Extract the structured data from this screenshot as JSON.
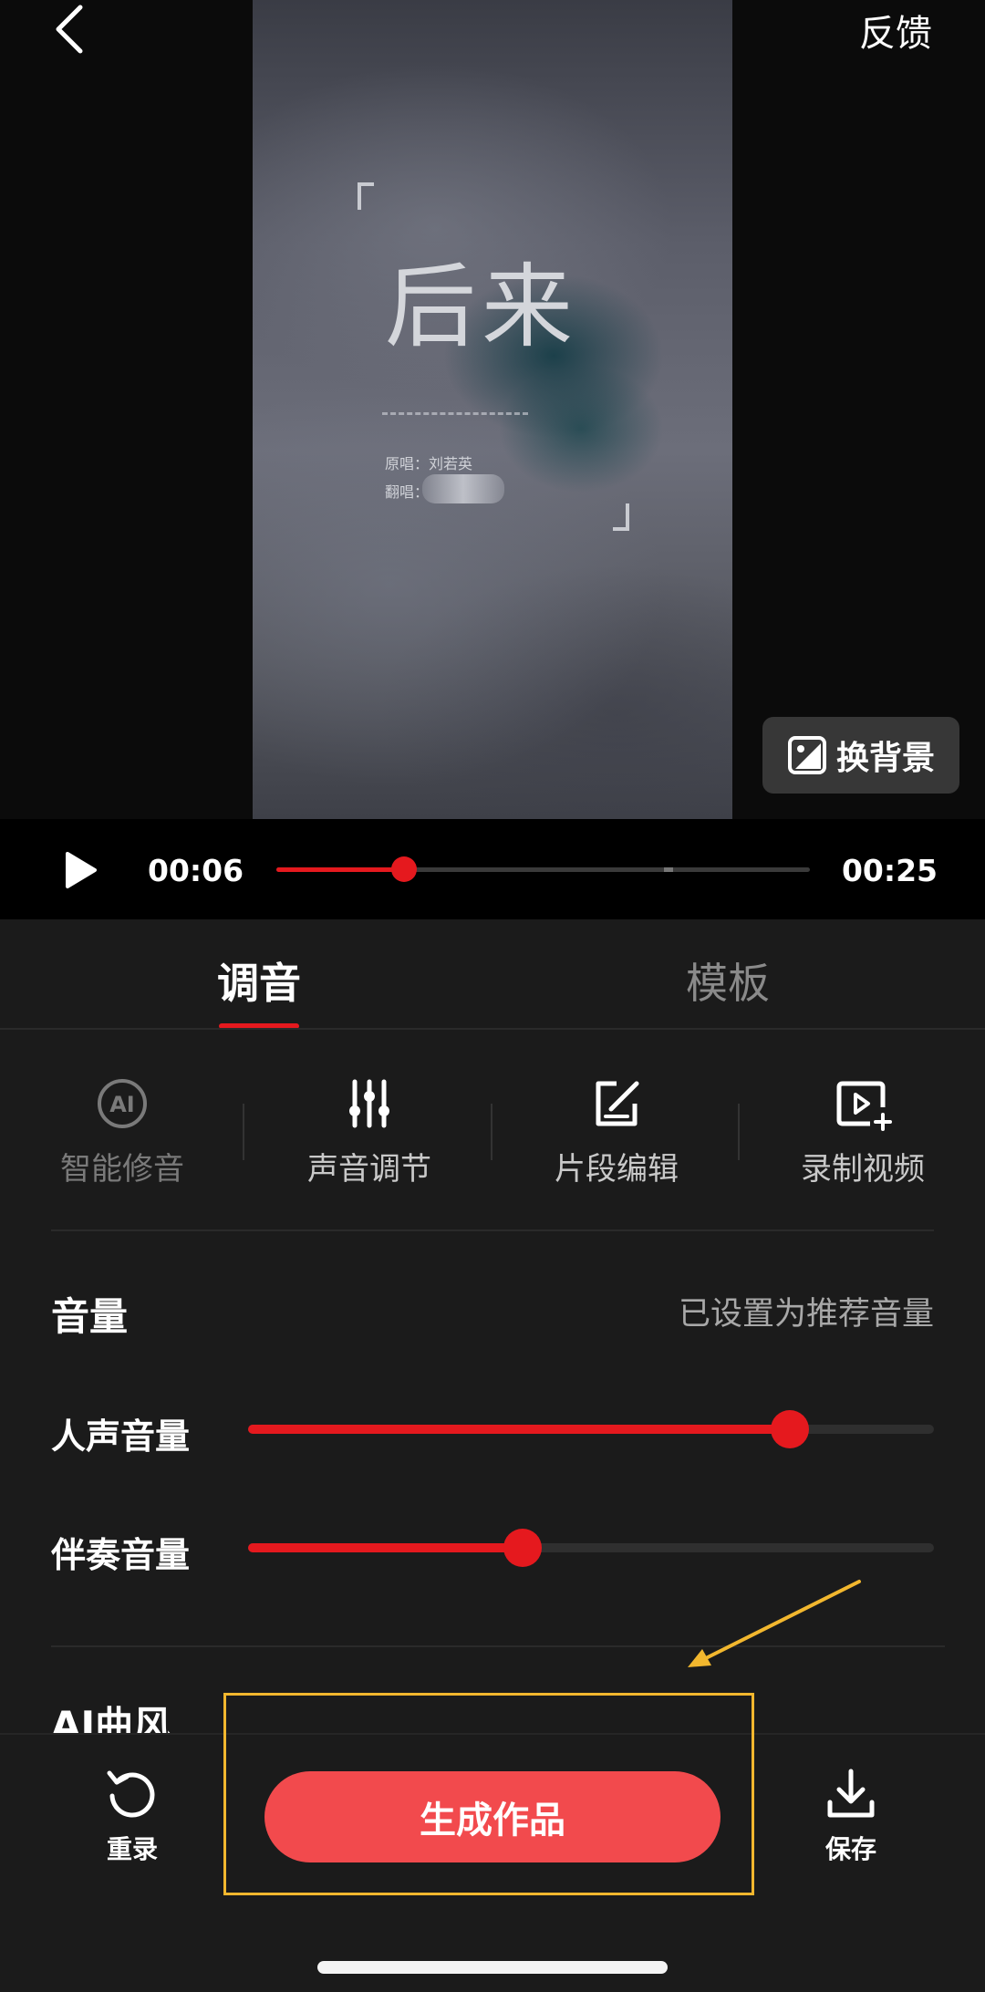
{
  "header": {
    "back_icon": "chevron-left-icon",
    "feedback_label": "反馈"
  },
  "video": {
    "title": "后来",
    "credit_original": "原唱：刘若英",
    "credit_cover": "翻唱："
  },
  "change_background": {
    "icon": "image-background-icon",
    "label": "换背景"
  },
  "player": {
    "play_icon": "play-icon",
    "current_time": "00:06",
    "total_time": "00:25",
    "progress_fraction": 0.24
  },
  "tabs": [
    {
      "label": "调音",
      "active": true
    },
    {
      "label": "模板",
      "active": false
    }
  ],
  "tools": [
    {
      "icon": "ai-badge-icon",
      "label": "智能修音",
      "enabled": false
    },
    {
      "icon": "equalizer-sliders-icon",
      "label": "声音调节",
      "enabled": true
    },
    {
      "icon": "edit-square-icon",
      "label": "片段编辑",
      "enabled": true
    },
    {
      "icon": "record-video-icon",
      "label": "录制视频",
      "enabled": true
    }
  ],
  "volume": {
    "title": "音量",
    "status": "已设置为推荐音量",
    "vocal": {
      "label": "人声音量",
      "level": 0.79
    },
    "accompaniment": {
      "label": "伴奏音量",
      "level": 0.4
    }
  },
  "ai_style": {
    "title": "AI曲风"
  },
  "bottom": {
    "rerecord_icon": "rotate-left-icon",
    "rerecord_label": "重录",
    "generate_label": "生成作品",
    "save_icon": "download-icon",
    "save_label": "保存"
  },
  "colors": {
    "accent_red": "#e5191e",
    "button_red": "#f24a4d",
    "highlight_yellow": "#f2b72e",
    "background": "#1b1b1b"
  }
}
